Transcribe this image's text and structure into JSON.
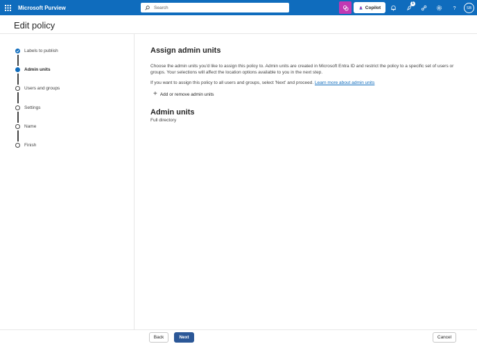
{
  "header": {
    "app_title": "Microsoft Purview",
    "search_placeholder": "Search",
    "copilot_label": "Copilot",
    "notification_badge": "1",
    "avatar_initials": "SB"
  },
  "page": {
    "title": "Edit policy"
  },
  "steps": [
    {
      "label": "Labels to publish",
      "state": "done"
    },
    {
      "label": "Admin units",
      "state": "active"
    },
    {
      "label": "Users and groups",
      "state": "todo"
    },
    {
      "label": "Settings",
      "state": "todo"
    },
    {
      "label": "Name",
      "state": "todo"
    },
    {
      "label": "Finish",
      "state": "todo"
    }
  ],
  "main": {
    "heading": "Assign admin units",
    "description": "Choose the admin units you'd like to assign this policy to. Admin units are created in Microsoft Entra ID and restrict the policy to a specific set of users or groups. Your selections will affect the location options available to you in the next step.",
    "description2": "If you want to assign this policy to all users and groups, select 'Next' and proceed.",
    "learn_more": "Learn more about admin units",
    "add_button": "Add or remove admin units",
    "admin_units_title": "Admin units",
    "admin_units_value": "Full directory"
  },
  "footer": {
    "back": "Back",
    "next": "Next",
    "cancel": "Cancel"
  },
  "colors": {
    "brand": "#0f6cbd",
    "purview_accent": "#c239b3",
    "primary_button": "#2b5797"
  }
}
